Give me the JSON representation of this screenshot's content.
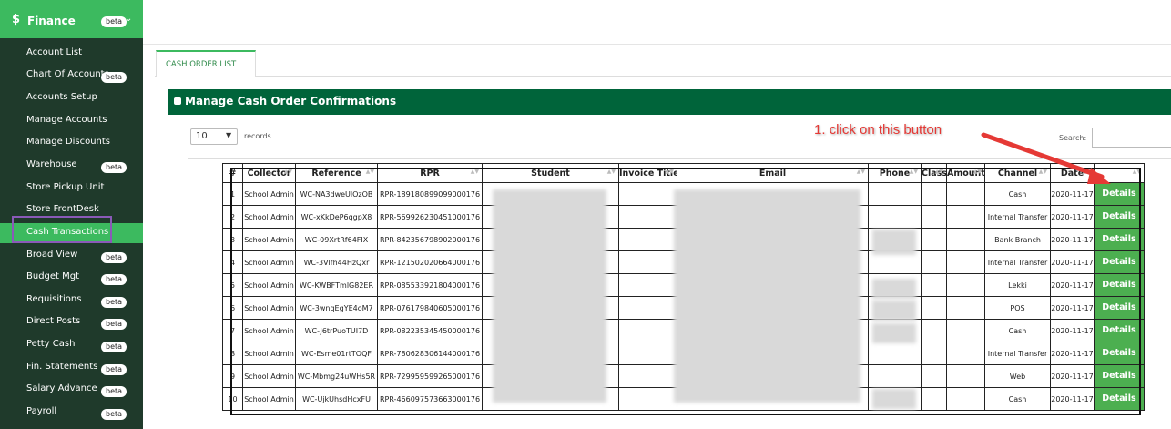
{
  "sidebar": {
    "header": {
      "icon": "dollar-icon",
      "title": "Finance",
      "badge": "beta"
    },
    "items": [
      {
        "label": "Account List",
        "badge": ""
      },
      {
        "label": "Chart Of Accounts",
        "badge": "beta"
      },
      {
        "label": "Accounts Setup",
        "badge": ""
      },
      {
        "label": "Manage Accounts",
        "badge": ""
      },
      {
        "label": "Manage Discounts",
        "badge": ""
      },
      {
        "label": "Warehouse",
        "badge": "beta"
      },
      {
        "label": "Store Pickup Unit",
        "badge": ""
      },
      {
        "label": "Store FrontDesk",
        "badge": ""
      },
      {
        "label": "Cash Transactions",
        "badge": ""
      },
      {
        "label": "Broad View",
        "badge": "beta"
      },
      {
        "label": "Budget Mgt",
        "badge": "beta"
      },
      {
        "label": "Requisitions",
        "badge": "beta"
      },
      {
        "label": "Direct Posts",
        "badge": "beta"
      },
      {
        "label": "Petty Cash",
        "badge": "beta"
      },
      {
        "label": "Fin. Statements",
        "badge": "beta"
      },
      {
        "label": "Salary Advance",
        "badge": "beta"
      },
      {
        "label": "Payroll",
        "badge": "beta"
      }
    ],
    "active_index": 8
  },
  "tab": {
    "label": "CASH ORDER LIST"
  },
  "panel": {
    "title": "Manage Cash Order Confirmations"
  },
  "controls": {
    "length_value": "10",
    "length_suffix": "records",
    "search_label": "Search:"
  },
  "annotation": "1. click on this button",
  "table": {
    "columns": [
      "#",
      "Collector",
      "Reference",
      "RPR",
      "Student",
      "Invoice Title",
      "Email",
      "Phone",
      "Class",
      "Amount",
      "Channel",
      "Date",
      ""
    ],
    "rows": [
      {
        "n": "1",
        "collector": "School Admin",
        "reference": "WC-NA3dweUlOzOB",
        "rpr": "RPR-189180899099000176",
        "channel": "Cash",
        "date": "2020-11-17",
        "action": "Details"
      },
      {
        "n": "2",
        "collector": "School Admin",
        "reference": "WC-xKkDeP6qgpX8",
        "rpr": "RPR-569926230451000176",
        "channel": "Internal Transfer",
        "date": "2020-11-17",
        "action": "Details"
      },
      {
        "n": "3",
        "collector": "School Admin",
        "reference": "WC-09XrtRf64FIX",
        "rpr": "RPR-842356798902000176",
        "channel": "Bank Branch",
        "date": "2020-11-17",
        "action": "Details"
      },
      {
        "n": "4",
        "collector": "School Admin",
        "reference": "WC-3Vlfh44HzQxr",
        "rpr": "RPR-121502020664000176",
        "channel": "Internal Transfer",
        "date": "2020-11-17",
        "action": "Details"
      },
      {
        "n": "5",
        "collector": "School Admin",
        "reference": "WC-KWBFTmlG82ER",
        "rpr": "RPR-085533921804000176",
        "channel": "Lekki",
        "date": "2020-11-17",
        "action": "Details"
      },
      {
        "n": "6",
        "collector": "School Admin",
        "reference": "WC-3wnqEgYE4oM7",
        "rpr": "RPR-076179840605000176",
        "channel": "POS",
        "date": "2020-11-17",
        "action": "Details"
      },
      {
        "n": "7",
        "collector": "School Admin",
        "reference": "WC-J6trPuoTUI7D",
        "rpr": "RPR-082235345450000176",
        "channel": "Cash",
        "date": "2020-11-17",
        "action": "Details"
      },
      {
        "n": "8",
        "collector": "School Admin",
        "reference": "WC-Esme01rtTOQF",
        "rpr": "RPR-780628306144000176",
        "channel": "Internal Transfer",
        "date": "2020-11-17",
        "action": "Details"
      },
      {
        "n": "9",
        "collector": "School Admin",
        "reference": "WC-Mbmg24uWHs5R",
        "rpr": "RPR-729959599265000176",
        "channel": "Web",
        "date": "2020-11-17",
        "action": "Details"
      },
      {
        "n": "10",
        "collector": "School Admin",
        "reference": "WC-UjkUhsdHcxFU",
        "rpr": "RPR-466097573663000176",
        "channel": "Cash",
        "date": "2020-11-17",
        "action": "Details"
      }
    ]
  },
  "colors": {
    "sidebar_bg": "#1f3a2b",
    "accent": "#3cba5f",
    "panel_header": "#00643a",
    "button": "#4caf50",
    "annotation": "#e53935"
  }
}
